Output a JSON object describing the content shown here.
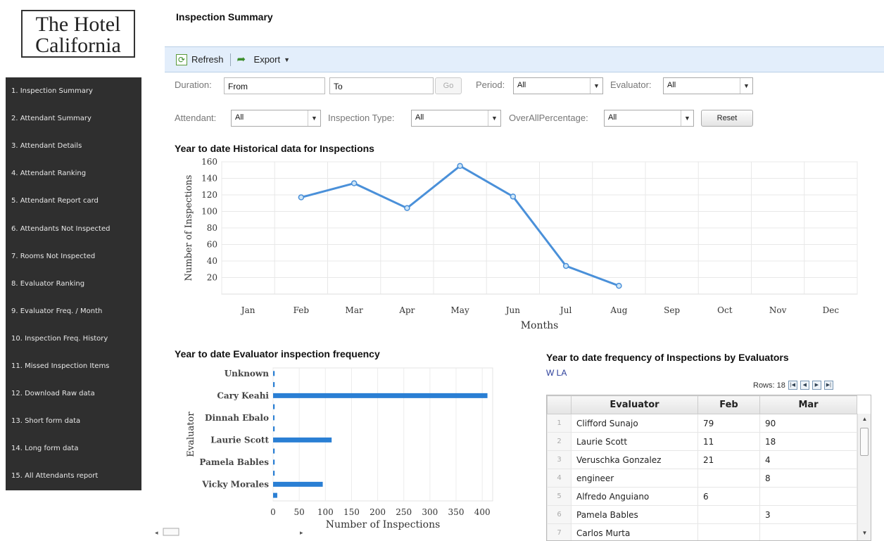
{
  "logo": {
    "line1": "The Hotel",
    "line2": "California"
  },
  "sidebar": {
    "items": [
      {
        "label": "1. Inspection Summary"
      },
      {
        "label": "2. Attendant Summary"
      },
      {
        "label": "3. Attendant Details"
      },
      {
        "label": "4. Attendant Ranking"
      },
      {
        "label": "5. Attendant Report card"
      },
      {
        "label": "6. Attendants Not Inspected"
      },
      {
        "label": "7. Rooms Not Inspected"
      },
      {
        "label": "8. Evaluator Ranking"
      },
      {
        "label": "9. Evaluator Freq. / Month"
      },
      {
        "label": "10. Inspection Freq. History"
      },
      {
        "label": "11. Missed Inspection Items"
      },
      {
        "label": "12. Download Raw data"
      },
      {
        "label": "13. Short form data"
      },
      {
        "label": "14. Long form data"
      },
      {
        "label": "15. All Attendants report"
      }
    ]
  },
  "header": {
    "title": "Inspection Summary"
  },
  "toolbar": {
    "refresh_label": "Refresh",
    "export_label": "Export"
  },
  "filters": {
    "duration_label": "Duration:",
    "from_value": "From",
    "to_value": "To",
    "go_label": "Go",
    "period_label": "Period:",
    "period_value": "All",
    "evaluator_label": "Evaluator:",
    "evaluator_value": "All",
    "attendant_label": "Attendant:",
    "attendant_value": "All",
    "inspection_type_label": "Inspection Type:",
    "inspection_type_value": "All",
    "overall_label": "OverAllPercentage:",
    "overall_value": "All",
    "reset_label": "Reset"
  },
  "chart_data": [
    {
      "type": "line",
      "title": "Year to date Historical data for Inspections",
      "xlabel": "Months",
      "ylabel": "Number of Inspections",
      "categories": [
        "Jan",
        "Feb",
        "Mar",
        "Apr",
        "May",
        "Jun",
        "Jul",
        "Aug",
        "Sep",
        "Oct",
        "Nov",
        "Dec"
      ],
      "values": [
        null,
        117,
        134,
        104,
        155,
        118,
        34,
        10,
        null,
        null,
        null,
        null
      ],
      "ylim": [
        0,
        160
      ],
      "yticks": [
        20,
        40,
        60,
        80,
        100,
        120,
        140,
        160
      ],
      "grid": true,
      "color": "#4a90d9"
    },
    {
      "type": "bar",
      "orientation": "horizontal",
      "title": "Year to date Evaluator inspection frequency",
      "xlabel": "Number of Inspections",
      "ylabel": "Evaluator",
      "categories": [
        "Unknown",
        "",
        "Cary Keahi",
        "",
        "Dinnah Ebalo",
        "",
        "Laurie Scott",
        "",
        "Pamela Bables",
        "",
        "Vicky Morales",
        ""
      ],
      "values": [
        3,
        3,
        410,
        3,
        1,
        3,
        112,
        3,
        3,
        3,
        95,
        8
      ],
      "xlim": [
        0,
        420
      ],
      "xticks": [
        0,
        50,
        100,
        150,
        200,
        250,
        300,
        350,
        400
      ],
      "grid": true,
      "color": "#2a7fd4"
    }
  ],
  "table": {
    "title": "Year to date frequency of Inspections by Evaluators",
    "link": "W LA",
    "rows_label": "Rows: 18",
    "pager": [
      "|◀",
      "◀",
      "▶",
      "▶|"
    ],
    "columns": [
      "Evaluator",
      "Feb",
      "Mar"
    ],
    "rows": [
      {
        "n": "1",
        "evaluator": "Clifford Sunajo",
        "feb": "79",
        "mar": "90"
      },
      {
        "n": "2",
        "evaluator": "Laurie Scott",
        "feb": "11",
        "mar": "18"
      },
      {
        "n": "3",
        "evaluator": "Veruschka Gonzalez",
        "feb": "21",
        "mar": "4"
      },
      {
        "n": "4",
        "evaluator": "engineer",
        "feb": "",
        "mar": "8"
      },
      {
        "n": "5",
        "evaluator": "Alfredo Anguiano",
        "feb": "6",
        "mar": ""
      },
      {
        "n": "6",
        "evaluator": "Pamela Bables",
        "feb": "",
        "mar": "3"
      },
      {
        "n": "7",
        "evaluator": "Carlos Murta",
        "feb": "",
        "mar": ""
      }
    ]
  }
}
